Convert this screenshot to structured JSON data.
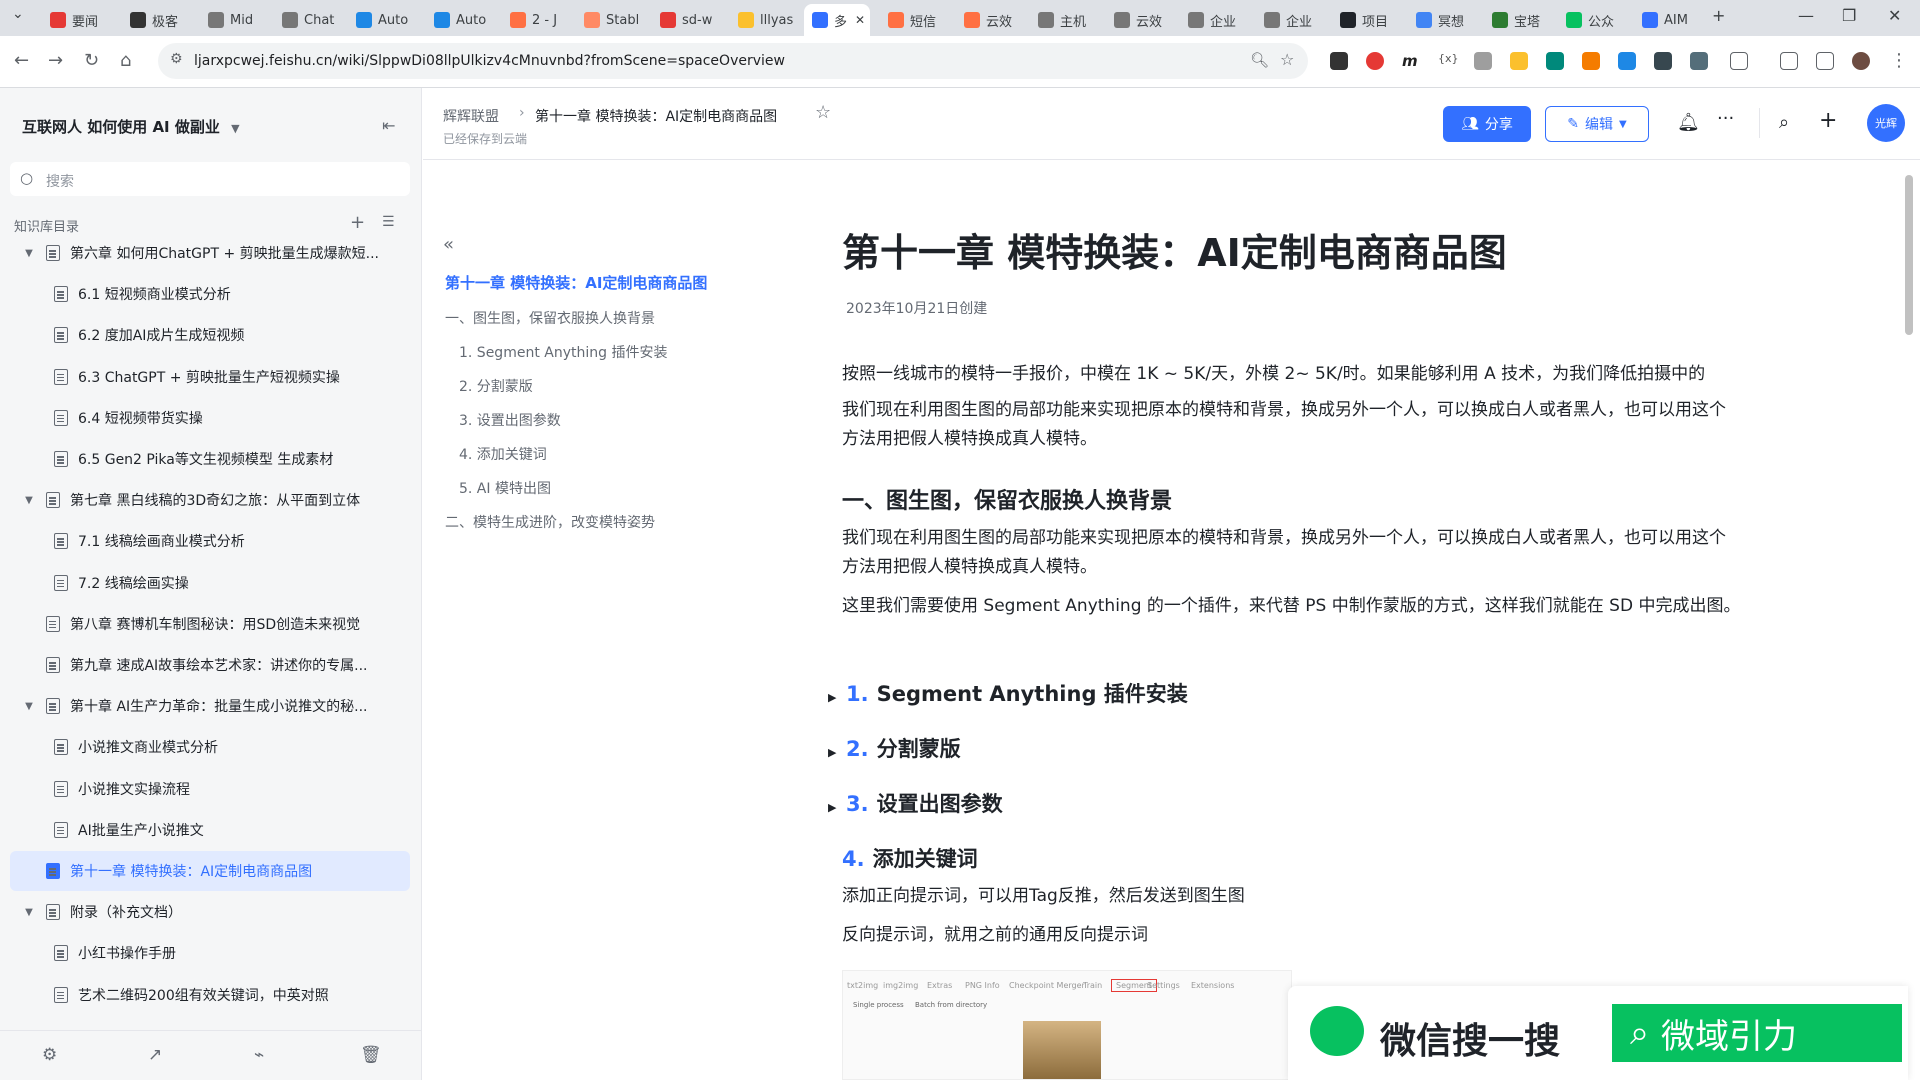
{
  "browser": {
    "tabs": [
      {
        "label": "要闻",
        "color": "#e53935"
      },
      {
        "label": "极客",
        "color": "#333333"
      },
      {
        "label": "Mid",
        "color": "#777777"
      },
      {
        "label": "Chat",
        "color": "#777777"
      },
      {
        "label": "Auto",
        "color": "#1e88e5"
      },
      {
        "label": "Auto",
        "color": "#1e88e5"
      },
      {
        "label": "2 - J",
        "color": "#ff7043"
      },
      {
        "label": "Stabl",
        "color": "#ff8a65"
      },
      {
        "label": "sd-w",
        "color": "#e53935"
      },
      {
        "label": "lllyas",
        "color": "#fbc02d"
      },
      {
        "label": "多",
        "color": "#3370ff",
        "active": true
      },
      {
        "label": "短信",
        "color": "#ff7043"
      },
      {
        "label": "云效",
        "color": "#ff7043"
      },
      {
        "label": "主机",
        "color": "#777777"
      },
      {
        "label": "云效",
        "color": "#777777"
      },
      {
        "label": "企业",
        "color": "#777777"
      },
      {
        "label": "企业",
        "color": "#777777"
      },
      {
        "label": "项目",
        "color": "#1f2329"
      },
      {
        "label": "冥想",
        "color": "#4285f4"
      },
      {
        "label": "宝塔",
        "color": "#2e7d32"
      },
      {
        "label": "公众",
        "color": "#07c160"
      },
      {
        "label": "AIM",
        "color": "#3370ff"
      }
    ],
    "url": "ljarxpcwej.feishu.cn/wiki/SlppwDi08llpUlkizv4cMnuvnbd?fromScene=spaceOverview"
  },
  "sidebar": {
    "space_title": "互联网人 如何使用 AI 做副业",
    "search_placeholder": "搜索",
    "toc_label": "知识库目录",
    "items": [
      {
        "label": "第六章 如何用ChatGPT + 剪映批量生成爆款短...",
        "level": 0,
        "expanded": true
      },
      {
        "label": "6.1 短视频商业模式分析",
        "level": 1
      },
      {
        "label": "6.2 度加AI成片生成短视频",
        "level": 1
      },
      {
        "label": "6.3 ChatGPT + 剪映批量生产短视频实操",
        "level": 1
      },
      {
        "label": "6.4 短视频带货实操",
        "level": 1
      },
      {
        "label": "6.5 Gen2 Pika等文生视频模型 生成素材",
        "level": 1
      },
      {
        "label": "第七章 黑白线稿的3D奇幻之旅：从平面到立体",
        "level": 0,
        "expanded": true
      },
      {
        "label": "7.1 线稿绘画商业模式分析",
        "level": 1
      },
      {
        "label": "7.2 线稿绘画实操",
        "level": 1
      },
      {
        "label": "第八章 赛博机车制图秘诀：用SD创造未来视觉",
        "level": 0
      },
      {
        "label": "第九章 速成AI故事绘本艺术家：讲述你的专属...",
        "level": 0
      },
      {
        "label": "第十章 AI生产力革命：批量生成小说推文的秘...",
        "level": 0,
        "expanded": true
      },
      {
        "label": "小说推文商业模式分析",
        "level": 1
      },
      {
        "label": "小说推文实操流程",
        "level": 1
      },
      {
        "label": "AI批量生产小说推文",
        "level": 1
      },
      {
        "label": "第十一章 模特换装：AI定制电商商品图",
        "level": 0,
        "active": true
      },
      {
        "label": "附录（补充文档）",
        "level": 0,
        "expanded": true
      },
      {
        "label": "小红书操作手册",
        "level": 1
      },
      {
        "label": "艺术二维码200组有效关键词，中英对照",
        "level": 1
      }
    ]
  },
  "header": {
    "breadcrumb_root": "辉辉联盟",
    "breadcrumb_current": "第十一章 模特换装：AI定制电商商品图",
    "saved_status": "已经保存到云端",
    "share_label": "分享",
    "edit_label": "编辑",
    "avatar_text": "光辉"
  },
  "outline": {
    "items": [
      {
        "label": "第十一章 模特换装：AI定制电商商品图",
        "active": true,
        "indent": 0
      },
      {
        "label": "一、图生图，保留衣服换人换背景",
        "indent": 0
      },
      {
        "label": "1. Segment Anything 插件安装",
        "indent": 1
      },
      {
        "label": "2. 分割蒙版",
        "indent": 1
      },
      {
        "label": "3. 设置出图参数",
        "indent": 1
      },
      {
        "label": "4. 添加关键词",
        "indent": 1
      },
      {
        "label": "5. AI 模特出图",
        "indent": 1
      },
      {
        "label": "二、模特生成进阶，改变模特姿势",
        "indent": 0
      }
    ]
  },
  "doc": {
    "title": "第十一章 模特换装：AI定制电商商品图",
    "created": "2023年10月21日创建",
    "para1": "按照一线城市的模特一手报价，中模在 1K ~ 5K/天，外模 2~ 5K/时。如果能够利用 A 技术，为我们降低拍摄中的",
    "para2": "我们现在利用图生图的局部功能来实现把原本的模特和背景，换成另外一个人，可以换成白人或者黑人，也可以用这个方法用把假人模特换成真人模特。",
    "section1": "一、图生图，保留衣服换人换背景",
    "para3": "我们现在利用图生图的局部功能来实现把原本的模特和背景，换成另外一个人，可以换成白人或者黑人，也可以用这个方法用把假人模特换成真人模特。",
    "para4": "这里我们需要使用 Segment Anything 的一个插件，来代替 PS 中制作蒙版的方式，这样我们就能在 SD 中完成出图。",
    "sub1_num": "1.",
    "sub1": "Segment Anything 插件安装",
    "sub2_num": "2.",
    "sub2": "分割蒙版",
    "sub3_num": "3.",
    "sub3": "设置出图参数",
    "sub4_num": "4.",
    "sub4": "添加关键词",
    "para5": "添加正向提示词，可以用Tag反推，然后发送到图生图",
    "para6": "反向提示词，就用之前的通用反向提示词",
    "img_tabs": [
      "txt2img",
      "img2img",
      "Extras",
      "PNG Info",
      "Checkpoint Merger",
      "Train",
      "Segment",
      "Settings",
      "Extensions"
    ],
    "img_subtabs": [
      "Single process",
      "Batch from directory"
    ]
  },
  "watermark": {
    "text": "微信搜一搜",
    "brand": "微域引力"
  }
}
